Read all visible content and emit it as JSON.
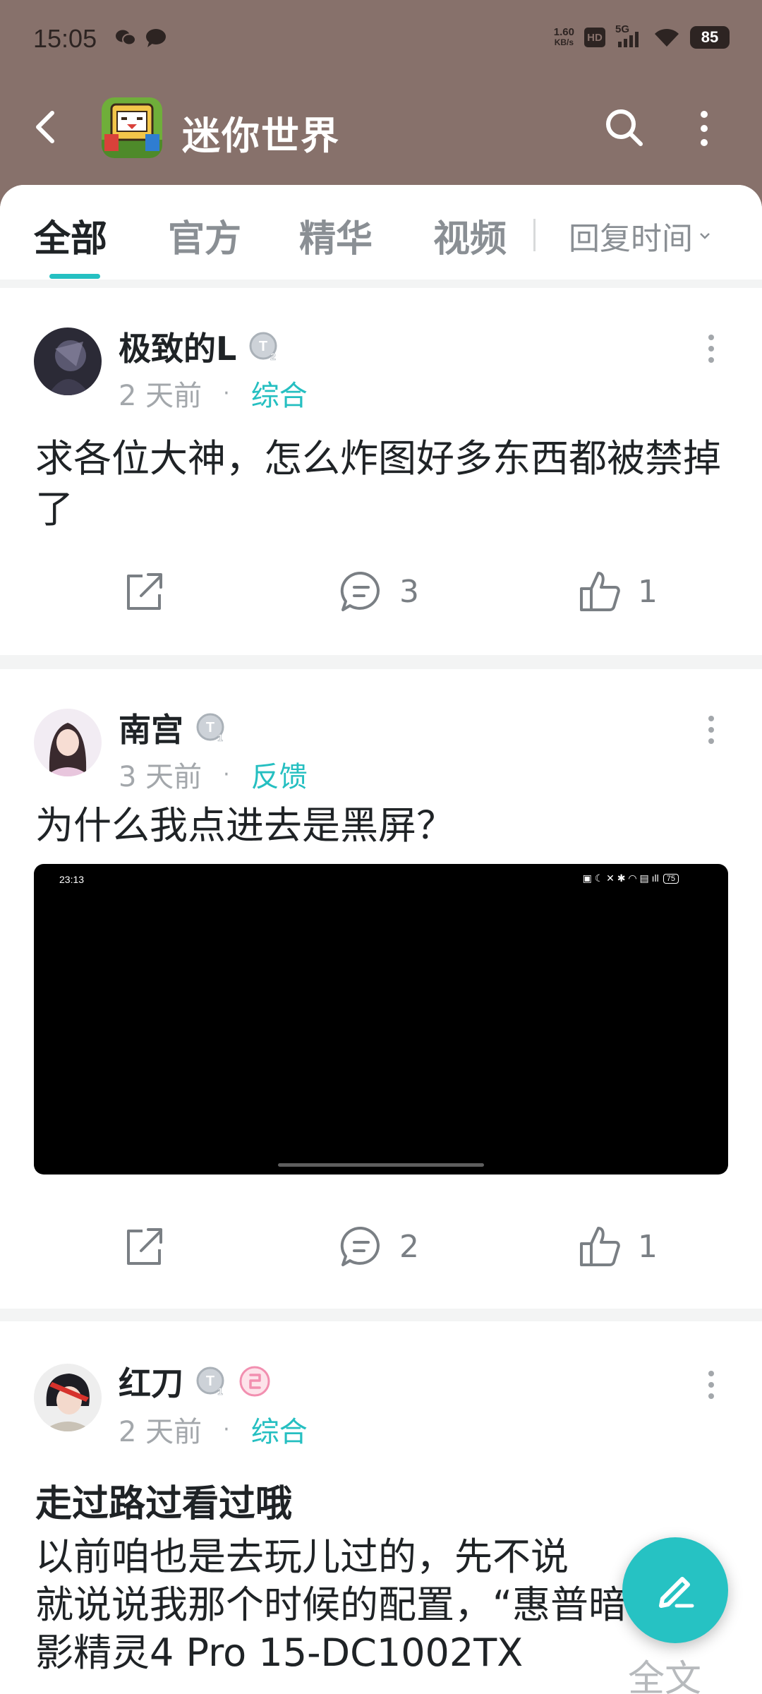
{
  "status": {
    "time": "15:05",
    "net_speed_value": "1.60",
    "net_speed_unit": "KB/s",
    "hd": "HD",
    "signal": "5G",
    "battery": "85"
  },
  "header": {
    "title": "迷你世界",
    "logo_icon": "mini-world-app-icon"
  },
  "tabs": [
    {
      "label": "全部",
      "active": true
    },
    {
      "label": "官方"
    },
    {
      "label": "精华"
    },
    {
      "label": "视频"
    }
  ],
  "sort_label": "回复时间",
  "posts": [
    {
      "user": "极致的L",
      "badge": "T",
      "badge_level": "2",
      "time": "2 天前",
      "category": "综合",
      "text": "求各位大神，怎么炸图好多东西都被禁掉了",
      "comments": "3",
      "likes": "1"
    },
    {
      "user": "南宫",
      "badge": "T",
      "badge_level": "1",
      "time": "3 天前",
      "category": "反馈",
      "text": "为什么我点进去是黑屏？",
      "screenshot_time": "23:13",
      "screenshot_battery": "75",
      "comments": "2",
      "likes": "1"
    },
    {
      "user": "红刀",
      "badge": "T",
      "badge_level": "1",
      "time": "2 天前",
      "category": "综合",
      "title": "走过路过看过哦",
      "text_lines": [
        "以前咱也是去玩儿过的，先不说",
        "就说说我那个时候的配置，“惠普暗",
        "影精灵4 Pro 15-DC1002TX"
      ],
      "more": "全文"
    }
  ],
  "colors": {
    "header_bg": "#87716b",
    "accent": "#25c0c2"
  }
}
